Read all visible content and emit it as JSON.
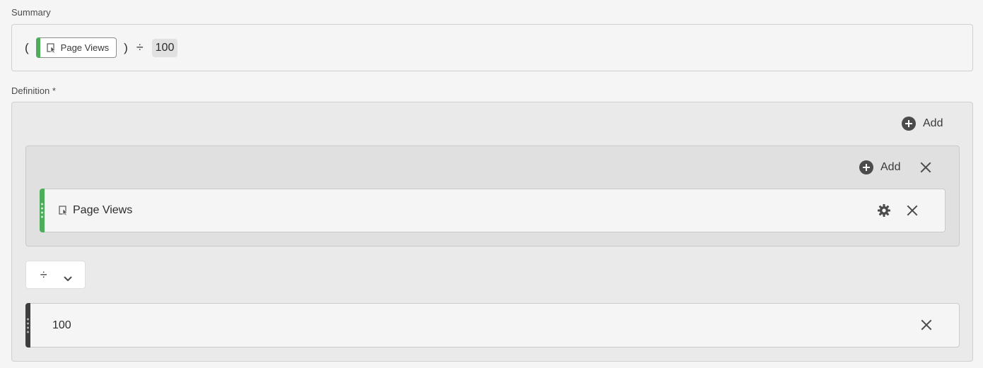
{
  "summary": {
    "label": "Summary",
    "open_paren": "(",
    "metric_label": "Page Views",
    "close_paren": ")",
    "operator": "÷",
    "number": "100"
  },
  "definition": {
    "label": "Definition",
    "required_marker": "*",
    "outer_add_label": "Add",
    "inner_add_label": "Add",
    "metric_name": "Page Views",
    "operator_symbol": "÷",
    "static_number": "100"
  },
  "colors": {
    "metric_accent": "#4ead5b",
    "static_accent": "#3e3e3e",
    "icon_color": "#4b4b4b"
  },
  "icons": [
    "metric-icon",
    "add-circle-icon",
    "close-icon",
    "gear-icon",
    "chevron-down-icon",
    "drag-handle-icon"
  ]
}
